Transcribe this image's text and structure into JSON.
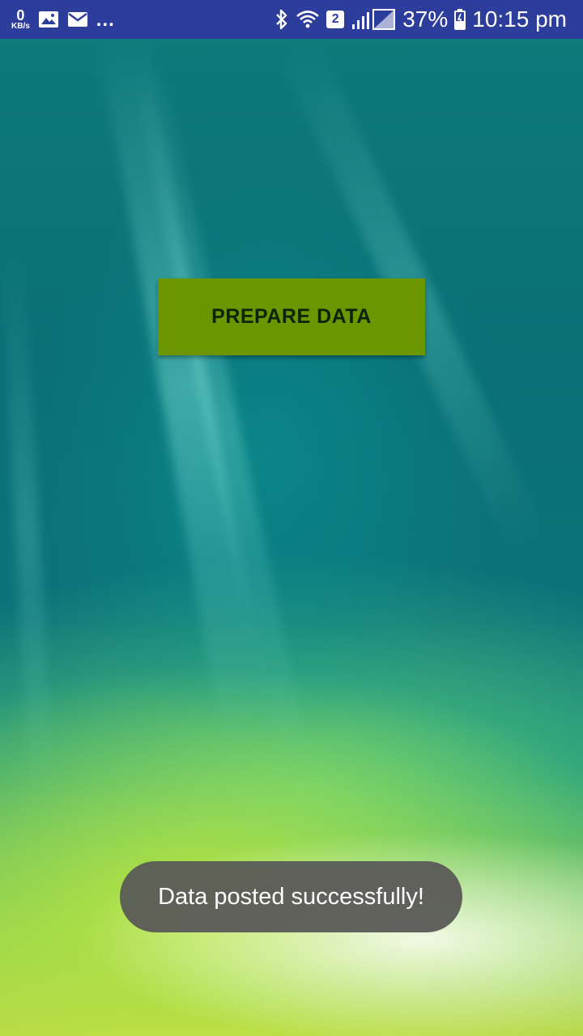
{
  "status_bar": {
    "net_speed_value": "0",
    "net_speed_unit": "KB/s",
    "overflow": "...",
    "sim_badge": "2",
    "battery_percent": "37%",
    "time": "10:15 pm",
    "icons": [
      "image-icon",
      "mail-icon",
      "bluetooth-icon",
      "wifi-icon",
      "signal-icon",
      "battery-icon"
    ],
    "bg_color": "#2d3d9b"
  },
  "main": {
    "prepare_button_label": "PREPARE DATA",
    "button_color": "#6b9600"
  },
  "toast": {
    "message": "Data posted successfully!"
  }
}
